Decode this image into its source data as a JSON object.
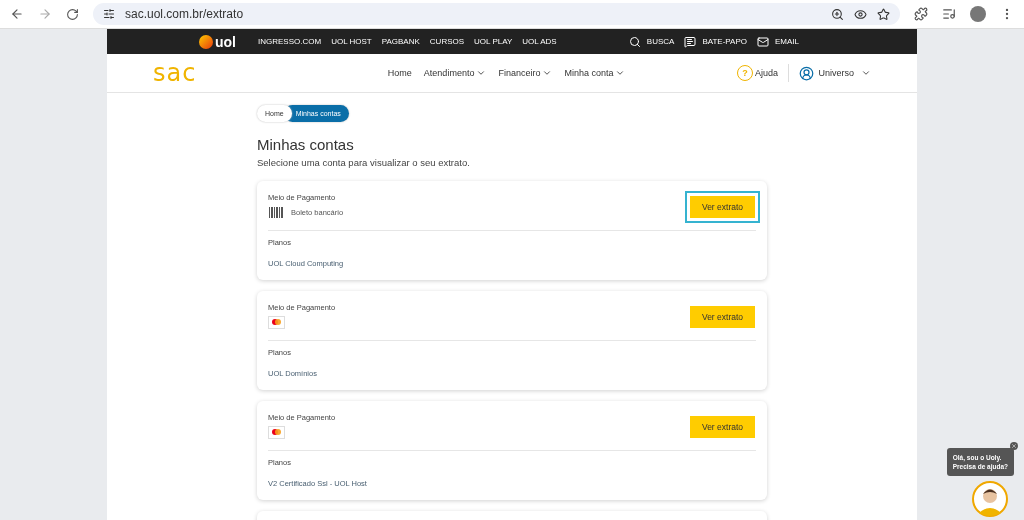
{
  "browser": {
    "url": "sac.uol.com.br/extrato"
  },
  "topbar": {
    "links": [
      "INGRESSO.COM",
      "UOL HOST",
      "PAGBANK",
      "CURSOS",
      "UOL PLAY",
      "UOL ADS"
    ],
    "actions": [
      {
        "kind": "search",
        "label": "BUSCA"
      },
      {
        "kind": "chat",
        "label": "BATE-PAPO"
      },
      {
        "kind": "mail",
        "label": "EMAIL"
      }
    ]
  },
  "brand": "uol",
  "header": {
    "logo": "sac",
    "help_mark": "?",
    "nav": [
      {
        "label": "Home",
        "dropdown": false
      },
      {
        "label": "Atendimento",
        "dropdown": true
      },
      {
        "label": "Financeiro",
        "dropdown": true
      },
      {
        "label": "Minha conta",
        "dropdown": true
      }
    ],
    "help": "Ajuda",
    "user": "Universo"
  },
  "breadcrumb": [
    {
      "label": "Home",
      "selected": false
    },
    {
      "label": "Minhas contas",
      "selected": true
    }
  ],
  "title": "Minhas contas",
  "subtitle": "Selecione uma conta para visualizar o seu extrato.",
  "accounts": [
    {
      "payment_label": "Meio de Pagamento",
      "kind": "boleto",
      "payment_name": "Boleto bancário",
      "button": "Ver extrato",
      "focused": true,
      "plans_label": "Planos",
      "plan": "UOL Cloud Computing"
    },
    {
      "payment_label": "Meio de Pagamento",
      "kind": "card",
      "button": "Ver extrato",
      "focused": false,
      "plans_label": "Planos",
      "plan": "UOL Domínios"
    },
    {
      "payment_label": "Meio de Pagamento",
      "kind": "card",
      "button": "Ver extrato",
      "focused": false,
      "plans_label": "Planos",
      "plan": "V2 Certificado Ssl - UOL Host"
    }
  ],
  "chat": {
    "lines": [
      "Olá, sou o Uoly.",
      "Precisa de ajuda?"
    ]
  }
}
